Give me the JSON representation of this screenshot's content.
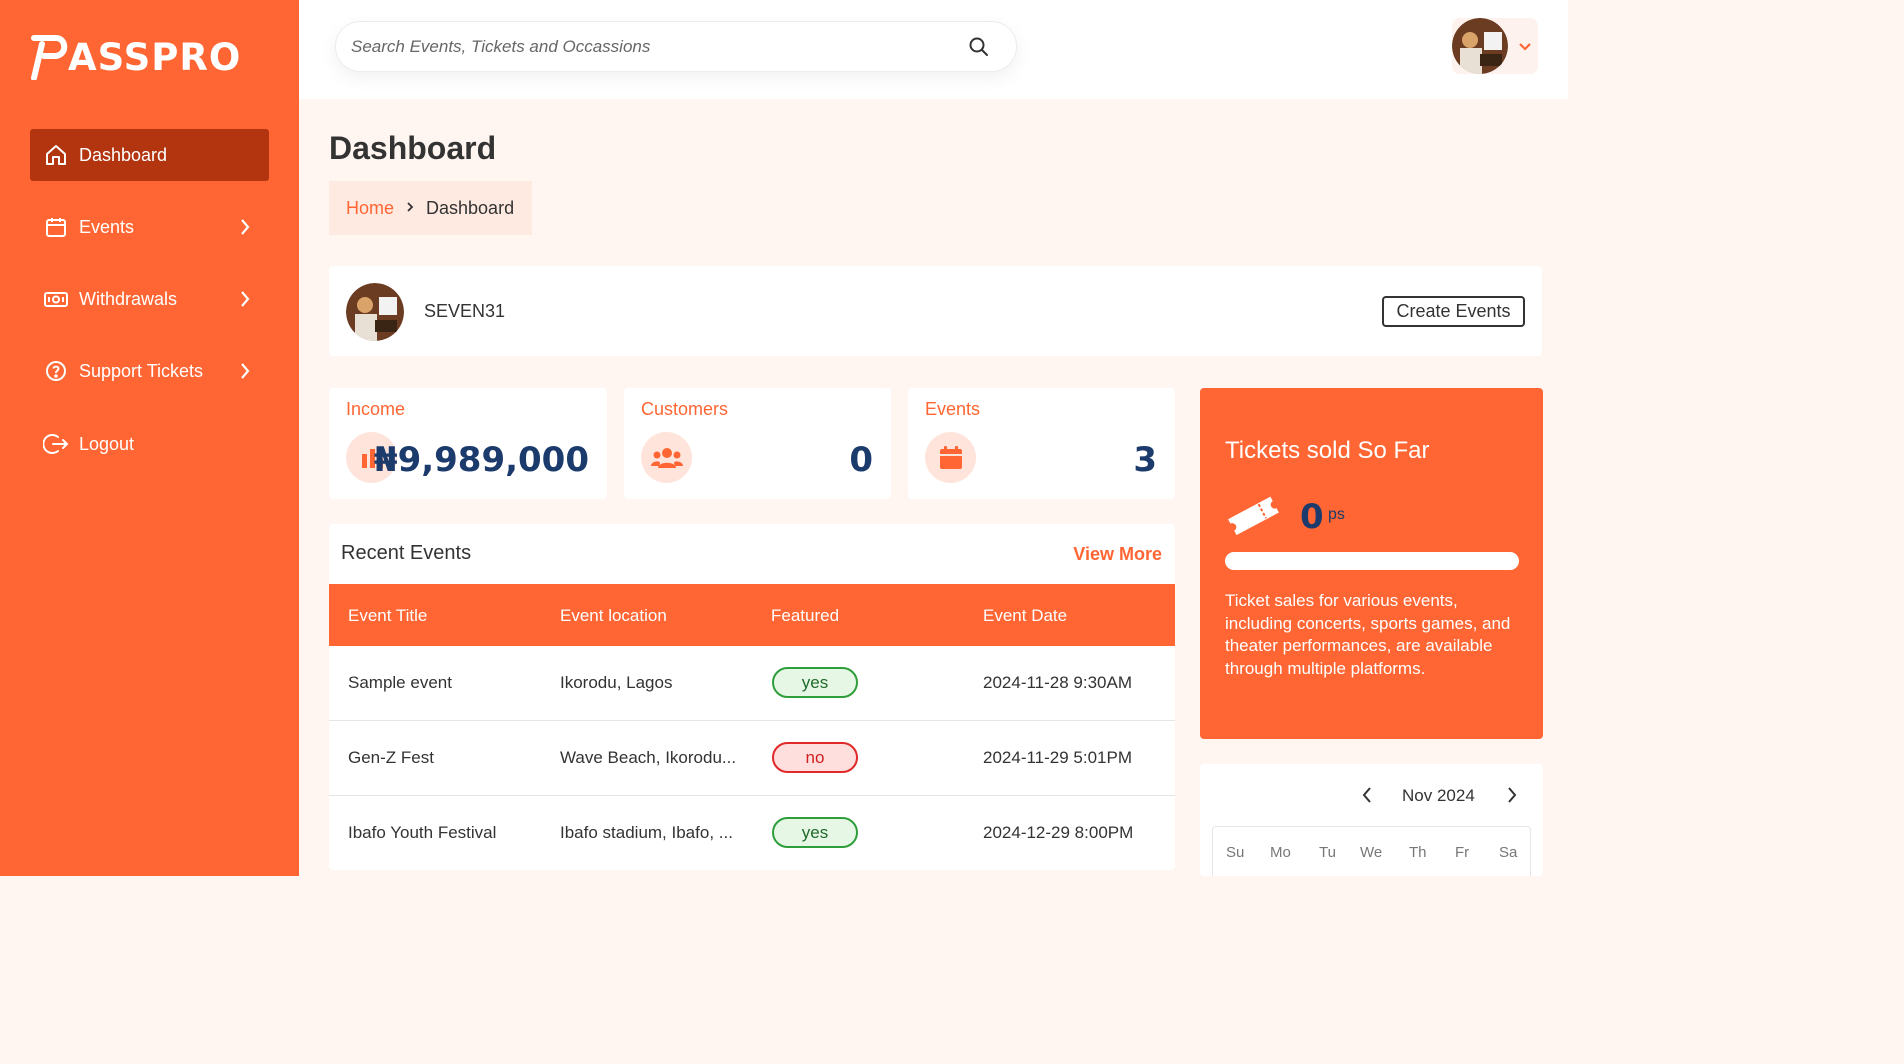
{
  "brand": {
    "name": "ASSPRO",
    "accent": "#ff6633",
    "navy": "#1a3b6b"
  },
  "sidebar": {
    "items": [
      {
        "label": "Dashboard",
        "icon": "home-icon",
        "active": true
      },
      {
        "label": "Events",
        "icon": "calendar-icon",
        "has_submenu": true
      },
      {
        "label": "Withdrawals",
        "icon": "cash-icon",
        "has_submenu": true
      },
      {
        "label": "Support Tickets",
        "icon": "help-icon",
        "has_submenu": true
      },
      {
        "label": "Logout",
        "icon": "logout-icon"
      }
    ]
  },
  "search": {
    "placeholder": "Search Events, Tickets and Occassions"
  },
  "page": {
    "title": "Dashboard"
  },
  "breadcrumb": {
    "home": "Home",
    "current": "Dashboard"
  },
  "profile": {
    "username": "SEVEN31",
    "create_label": "Create Events"
  },
  "stats": {
    "income": {
      "label": "Income",
      "value": "₦9,989,000"
    },
    "customers": {
      "label": "Customers",
      "value": "0"
    },
    "events": {
      "label": "Events",
      "value": "3"
    }
  },
  "recent": {
    "title": "Recent Events",
    "view_more": "View More",
    "columns": [
      "Event Title",
      "Event location",
      "Featured",
      "Event Date"
    ],
    "rows": [
      {
        "title": "Sample event",
        "location": "Ikorodu, Lagos",
        "featured": "yes",
        "date": "2024-11-28 9:30AM"
      },
      {
        "title": "Gen-Z Fest",
        "location": "Wave Beach, Ikorodu...",
        "featured": "no",
        "date": "2024-11-29 5:01PM"
      },
      {
        "title": "Ibafo Youth Festival",
        "location": "Ibafo stadium, Ibafo, ...",
        "featured": "yes",
        "date": "2024-12-29 8:00PM"
      }
    ]
  },
  "tickets": {
    "title": "Tickets sold So Far",
    "count": "0",
    "unit": "ps",
    "progress": 0,
    "description": "Ticket sales for various events, including concerts, sports games, and theater performances, are available through multiple platforms."
  },
  "calendar": {
    "month": "Nov 2024",
    "weekdays": [
      "Su",
      "Mo",
      "Tu",
      "We",
      "Th",
      "Fr",
      "Sa"
    ]
  }
}
